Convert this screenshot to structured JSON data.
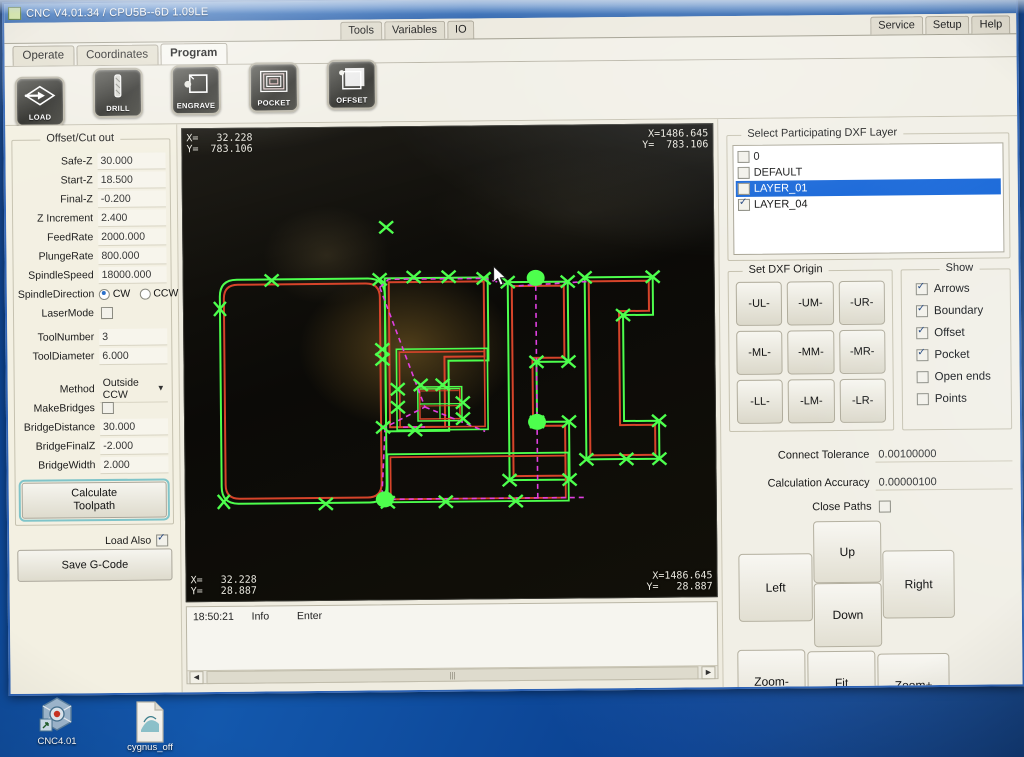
{
  "window": {
    "title": "CNC V4.01.34 / CPU5B--6D 1.09LE",
    "menu_tabs": [
      "Tools",
      "Variables",
      "IO"
    ],
    "menu_tabs_right": [
      "Service",
      "Setup",
      "Help"
    ],
    "sub_tabs": [
      {
        "label": "Operate",
        "active": false
      },
      {
        "label": "Coordinates",
        "active": false
      },
      {
        "label": "Program",
        "active": true
      }
    ]
  },
  "toolbar": {
    "buttons": [
      {
        "label": "LOAD",
        "icon": "load-arrow-icon"
      },
      {
        "label": "DRILL",
        "icon": "drill-bit-icon"
      },
      {
        "label": "ENGRAVE",
        "icon": "engrave-icon"
      },
      {
        "label": "POCKET",
        "icon": "pocket-spiral-icon"
      },
      {
        "label": "OFFSET",
        "icon": "offset-icon"
      }
    ]
  },
  "left_panel": {
    "group_title": "Offset/Cut out",
    "fields": [
      {
        "label": "Safe-Z",
        "value": "30.000"
      },
      {
        "label": "Start-Z",
        "value": "18.500"
      },
      {
        "label": "Final-Z",
        "value": "-0.200"
      },
      {
        "label": "Z Increment",
        "value": "2.400"
      },
      {
        "label": "FeedRate",
        "value": "2000.000"
      },
      {
        "label": "PlungeRate",
        "value": "800.000"
      },
      {
        "label": "SpindleSpeed",
        "value": "18000.000"
      }
    ],
    "spindle_direction": {
      "label": "SpindleDirection",
      "options": [
        "CW",
        "CCW"
      ],
      "selected": "CW"
    },
    "laser_mode": {
      "label": "LaserMode",
      "checked": false
    },
    "tool_fields": [
      {
        "label": "ToolNumber",
        "value": "3"
      },
      {
        "label": "ToolDiameter",
        "value": "6.000"
      }
    ],
    "method": {
      "label": "Method",
      "value": "Outside CCW"
    },
    "make_bridges": {
      "label": "MakeBridges",
      "checked": false
    },
    "bridge_fields": [
      {
        "label": "BridgeDistance",
        "value": "30.000"
      },
      {
        "label": "BridgeFinalZ",
        "value": "-2.000"
      },
      {
        "label": "BridgeWidth",
        "value": "2.000"
      }
    ],
    "calculate_button": "Calculate\nToolpath",
    "calculate_button_l1": "Calculate",
    "calculate_button_l2": "Toolpath",
    "load_also": {
      "label": "Load Also",
      "checked": true
    },
    "save_button": "Save G-Code"
  },
  "viewport": {
    "corner_top_left": "X=   32.228\nY=  783.106",
    "corner_top_right": "X=1486.645\nY=  783.106",
    "corner_bottom_left": "X=   32.228\nY=   28.887",
    "corner_bottom_right": "X=1486.645\nY=   28.887",
    "colors": {
      "toolpath": "#39e03a",
      "offset": "#d6442a",
      "rapid": "#e040e0",
      "background": "#0a0906"
    }
  },
  "status_bar": {
    "time": "18:50:21",
    "type": "Info",
    "message": "Enter",
    "scroll_thumb": "|||"
  },
  "right_panel": {
    "layer_group_title": "Select Participating DXF Layer",
    "layers": [
      {
        "name": "0",
        "checked": false,
        "selected": false
      },
      {
        "name": "DEFAULT",
        "checked": false,
        "selected": false
      },
      {
        "name": "LAYER_01",
        "checked": false,
        "selected": true
      },
      {
        "name": "LAYER_04",
        "checked": true,
        "selected": false
      }
    ],
    "origin_group_title": "Set DXF Origin",
    "origin_buttons": [
      "-UL-",
      "-UM-",
      "-UR-",
      "-ML-",
      "-MM-",
      "-MR-",
      "-LL-",
      "-LM-",
      "-LR-"
    ],
    "show_group_title": "Show",
    "show_options": [
      {
        "label": "Arrows",
        "checked": true
      },
      {
        "label": "Boundary",
        "checked": true
      },
      {
        "label": "Offset",
        "checked": true
      },
      {
        "label": "Pocket",
        "checked": true
      },
      {
        "label": "Open ends",
        "checked": false
      },
      {
        "label": "Points",
        "checked": false
      }
    ],
    "tolerances": [
      {
        "label": "Connect Tolerance",
        "value": "0.00100000"
      },
      {
        "label": "Calculation Accuracy",
        "value": "0.00000100"
      }
    ],
    "close_paths": {
      "label": "Close Paths",
      "checked": false
    },
    "nav_buttons": {
      "up": "Up",
      "down": "Down",
      "left": "Left",
      "right": "Right",
      "zoom_out": "Zoom-",
      "fit": "Fit",
      "zoom_in": "Zoom+"
    }
  },
  "desktop": {
    "icons": [
      {
        "label": "CNC4.01",
        "icon": "cnc-app-icon"
      },
      {
        "label": "cygnus_off",
        "icon": "document-icon"
      }
    ]
  }
}
